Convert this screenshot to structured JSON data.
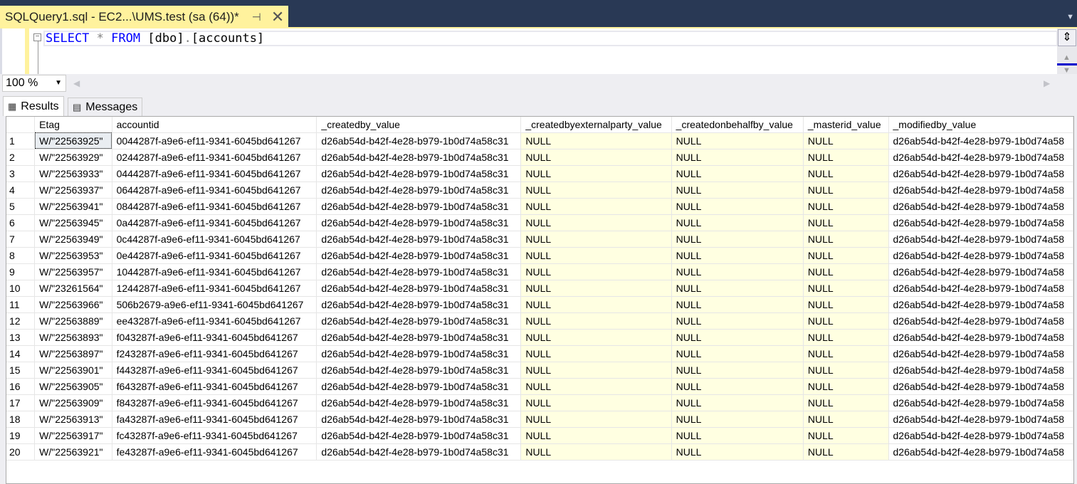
{
  "document_tab": {
    "title": "SQLQuery1.sql - EC2...\\UMS.test (sa (64))*",
    "pin_icon": "pin-icon",
    "close_icon": "close-icon"
  },
  "editor": {
    "keyword_select": "SELECT",
    "star": "*",
    "keyword_from": "FROM",
    "object": "[dbo]",
    "dot": ".",
    "table": "[accounts]",
    "fold_symbol": "−"
  },
  "zoom": {
    "value": "100 %"
  },
  "result_tabs": [
    {
      "label": "Results",
      "icon": "grid-icon"
    },
    {
      "label": "Messages",
      "icon": "messages-icon"
    }
  ],
  "grid": {
    "columns": [
      "",
      "Etag",
      "accountid",
      "_createdby_value",
      "_createdbyexternalparty_value",
      "_createdonbehalfby_value",
      "_masterid_value",
      "_modifiedby_value"
    ],
    "created_by": "d26ab54d-b42f-4e28-b979-1b0d74a58c31",
    "modified_by_visible": "d26ab54d-b42f-4e28-b979-1b0d74a58",
    "null_text": "NULL",
    "rows": [
      [
        "1",
        "W/\"22563925\"",
        "0044287f-a9e6-ef11-9341-6045bd641267"
      ],
      [
        "2",
        "W/\"22563929\"",
        "0244287f-a9e6-ef11-9341-6045bd641267"
      ],
      [
        "3",
        "W/\"22563933\"",
        "0444287f-a9e6-ef11-9341-6045bd641267"
      ],
      [
        "4",
        "W/\"22563937\"",
        "0644287f-a9e6-ef11-9341-6045bd641267"
      ],
      [
        "5",
        "W/\"22563941\"",
        "0844287f-a9e6-ef11-9341-6045bd641267"
      ],
      [
        "6",
        "W/\"22563945\"",
        "0a44287f-a9e6-ef11-9341-6045bd641267"
      ],
      [
        "7",
        "W/\"22563949\"",
        "0c44287f-a9e6-ef11-9341-6045bd641267"
      ],
      [
        "8",
        "W/\"22563953\"",
        "0e44287f-a9e6-ef11-9341-6045bd641267"
      ],
      [
        "9",
        "W/\"22563957\"",
        "1044287f-a9e6-ef11-9341-6045bd641267"
      ],
      [
        "10",
        "W/\"23261564\"",
        "1244287f-a9e6-ef11-9341-6045bd641267"
      ],
      [
        "11",
        "W/\"22563966\"",
        "506b2679-a9e6-ef11-9341-6045bd641267"
      ],
      [
        "12",
        "W/\"22563889\"",
        "ee43287f-a9e6-ef11-9341-6045bd641267"
      ],
      [
        "13",
        "W/\"22563893\"",
        "f043287f-a9e6-ef11-9341-6045bd641267"
      ],
      [
        "14",
        "W/\"22563897\"",
        "f243287f-a9e6-ef11-9341-6045bd641267"
      ],
      [
        "15",
        "W/\"22563901\"",
        "f443287f-a9e6-ef11-9341-6045bd641267"
      ],
      [
        "16",
        "W/\"22563905\"",
        "f643287f-a9e6-ef11-9341-6045bd641267"
      ],
      [
        "17",
        "W/\"22563909\"",
        "f843287f-a9e6-ef11-9341-6045bd641267"
      ],
      [
        "18",
        "W/\"22563913\"",
        "fa43287f-a9e6-ef11-9341-6045bd641267"
      ],
      [
        "19",
        "W/\"22563917\"",
        "fc43287f-a9e6-ef11-9341-6045bd641267"
      ],
      [
        "20",
        "W/\"22563921\"",
        "fe43287f-a9e6-ef11-9341-6045bd641267"
      ]
    ]
  },
  "colors": {
    "title_bar": "#293955",
    "active_tab": "#fff29d",
    "null_cell": "#ffffe1",
    "keyword": "#0000ff"
  }
}
